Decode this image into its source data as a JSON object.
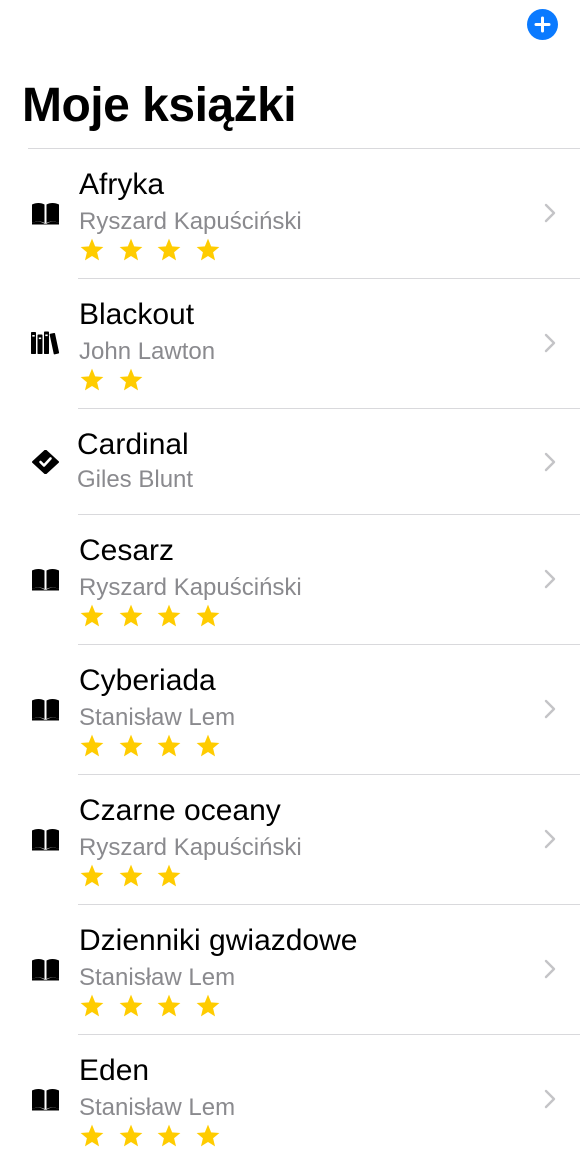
{
  "header": {
    "title": "Moje książki",
    "add_button_icon": "plus-icon"
  },
  "colors": {
    "accent": "#0a7aff",
    "star": "#ffcc00",
    "secondary_text": "#8a8a8e",
    "separator": "#d9d9dc"
  },
  "books": [
    {
      "title": "Afryka",
      "author": "Ryszard Kapuściński",
      "rating": 4,
      "status_icon": "book-open-icon"
    },
    {
      "title": "Blackout",
      "author": "John Lawton",
      "rating": 2,
      "status_icon": "books-on-shelf-icon"
    },
    {
      "title": "Cardinal",
      "author": "Giles Blunt",
      "rating": 0,
      "status_icon": "checkmark-seal-icon"
    },
    {
      "title": "Cesarz",
      "author": "Ryszard Kapuściński",
      "rating": 4,
      "status_icon": "book-open-icon"
    },
    {
      "title": "Cyberiada",
      "author": "Stanisław Lem",
      "rating": 4,
      "status_icon": "book-open-icon"
    },
    {
      "title": "Czarne oceany",
      "author": "Ryszard Kapuściński",
      "rating": 3,
      "status_icon": "book-open-icon"
    },
    {
      "title": "Dzienniki gwiazdowe",
      "author": "Stanisław Lem",
      "rating": 4,
      "status_icon": "book-open-icon"
    },
    {
      "title": "Eden",
      "author": "Stanisław Lem",
      "rating": 4,
      "status_icon": "book-open-icon"
    }
  ]
}
